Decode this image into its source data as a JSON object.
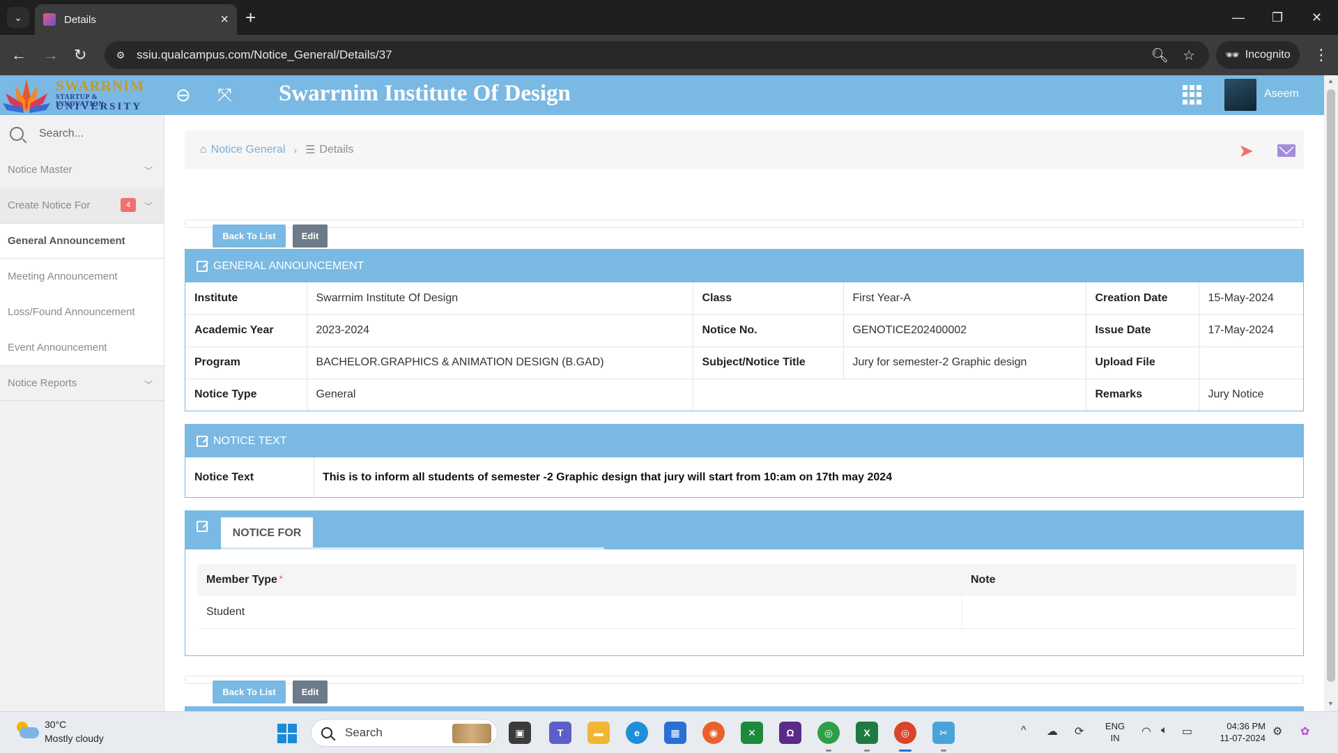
{
  "browser": {
    "tab_title": "Details",
    "url": "ssiu.qualcampus.com/Notice_General/Details/37",
    "incognito_label": "Incognito"
  },
  "header": {
    "logo_main": "SWARRNIM",
    "logo_sub": "STARTUP & INNOVATION",
    "logo_sub2": "UNIVERSITY",
    "title": "Swarrnim Institute Of Design",
    "user_name": "Aseem"
  },
  "sidebar": {
    "search_placeholder": "Search...",
    "items": [
      {
        "label": "Notice Master"
      },
      {
        "label": "Create Notice For",
        "badge": "4"
      },
      {
        "label": "General Announcement"
      },
      {
        "label": "Meeting Announcement"
      },
      {
        "label": "Loss/Found Announcement"
      },
      {
        "label": "Event Announcement"
      },
      {
        "label": "Notice Reports"
      }
    ]
  },
  "breadcrumb": {
    "home": "Notice General",
    "current": "Details"
  },
  "buttons": {
    "back": "Back To List",
    "edit": "Edit"
  },
  "general": {
    "heading": "GENERAL ANNOUNCEMENT",
    "rows": [
      [
        {
          "label": "Institute",
          "value": "Swarrnim Institute Of Design"
        },
        {
          "label": "Class",
          "value": "First Year-A"
        },
        {
          "label": "Creation Date",
          "value": "15-May-2024"
        }
      ],
      [
        {
          "label": "Academic Year",
          "value": "2023-2024"
        },
        {
          "label": "Notice No.",
          "value": "GENOTICE202400002"
        },
        {
          "label": "Issue Date",
          "value": "17-May-2024"
        }
      ],
      [
        {
          "label": "Program",
          "value": "BACHELOR.GRAPHICS & ANIMATION DESIGN (B.GAD)"
        },
        {
          "label": "Subject/Notice Title",
          "value": "Jury for semester-2 Graphic design"
        },
        {
          "label": "Upload File",
          "value": ""
        }
      ],
      [
        {
          "label": "Notice Type",
          "value": "General"
        },
        {
          "label": "",
          "value": ""
        },
        {
          "label": "Remarks",
          "value": "Jury Notice"
        }
      ]
    ]
  },
  "notice_text": {
    "heading": "NOTICE TEXT",
    "label": "Notice Text",
    "value": "This is to inform all students of semester -2 Graphic design that jury will start from 10:am on 17th may 2024"
  },
  "notice_for": {
    "tab": "NOTICE FOR",
    "columns": [
      "Member Type",
      "Note"
    ],
    "required_mark": "*",
    "rows": [
      {
        "member_type": "Student",
        "note": ""
      }
    ]
  },
  "taskbar": {
    "temperature": "30°C",
    "weather": "Mostly cloudy",
    "search_label": "Search",
    "lang_line1": "ENG",
    "lang_line2": "IN",
    "time": "04:36 PM",
    "date": "11-07-2024"
  }
}
